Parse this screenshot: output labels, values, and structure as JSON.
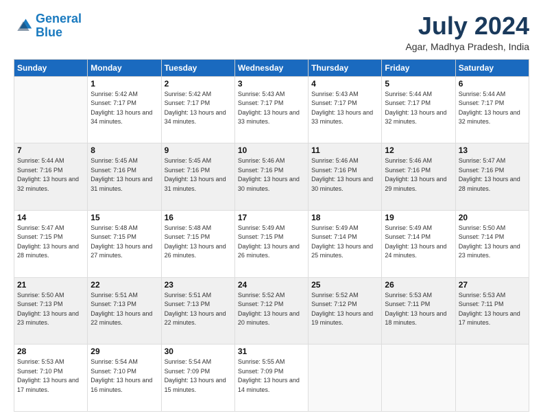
{
  "logo": {
    "line1": "General",
    "line2": "Blue"
  },
  "title": {
    "month_year": "July 2024",
    "location": "Agar, Madhya Pradesh, India"
  },
  "weekdays": [
    "Sunday",
    "Monday",
    "Tuesday",
    "Wednesday",
    "Thursday",
    "Friday",
    "Saturday"
  ],
  "weeks": [
    [
      {
        "day": "",
        "sunrise": "",
        "sunset": "",
        "daylight": ""
      },
      {
        "day": "1",
        "sunrise": "Sunrise: 5:42 AM",
        "sunset": "Sunset: 7:17 PM",
        "daylight": "Daylight: 13 hours and 34 minutes."
      },
      {
        "day": "2",
        "sunrise": "Sunrise: 5:42 AM",
        "sunset": "Sunset: 7:17 PM",
        "daylight": "Daylight: 13 hours and 34 minutes."
      },
      {
        "day": "3",
        "sunrise": "Sunrise: 5:43 AM",
        "sunset": "Sunset: 7:17 PM",
        "daylight": "Daylight: 13 hours and 33 minutes."
      },
      {
        "day": "4",
        "sunrise": "Sunrise: 5:43 AM",
        "sunset": "Sunset: 7:17 PM",
        "daylight": "Daylight: 13 hours and 33 minutes."
      },
      {
        "day": "5",
        "sunrise": "Sunrise: 5:44 AM",
        "sunset": "Sunset: 7:17 PM",
        "daylight": "Daylight: 13 hours and 32 minutes."
      },
      {
        "day": "6",
        "sunrise": "Sunrise: 5:44 AM",
        "sunset": "Sunset: 7:17 PM",
        "daylight": "Daylight: 13 hours and 32 minutes."
      }
    ],
    [
      {
        "day": "7",
        "sunrise": "Sunrise: 5:44 AM",
        "sunset": "Sunset: 7:16 PM",
        "daylight": "Daylight: 13 hours and 32 minutes."
      },
      {
        "day": "8",
        "sunrise": "Sunrise: 5:45 AM",
        "sunset": "Sunset: 7:16 PM",
        "daylight": "Daylight: 13 hours and 31 minutes."
      },
      {
        "day": "9",
        "sunrise": "Sunrise: 5:45 AM",
        "sunset": "Sunset: 7:16 PM",
        "daylight": "Daylight: 13 hours and 31 minutes."
      },
      {
        "day": "10",
        "sunrise": "Sunrise: 5:46 AM",
        "sunset": "Sunset: 7:16 PM",
        "daylight": "Daylight: 13 hours and 30 minutes."
      },
      {
        "day": "11",
        "sunrise": "Sunrise: 5:46 AM",
        "sunset": "Sunset: 7:16 PM",
        "daylight": "Daylight: 13 hours and 30 minutes."
      },
      {
        "day": "12",
        "sunrise": "Sunrise: 5:46 AM",
        "sunset": "Sunset: 7:16 PM",
        "daylight": "Daylight: 13 hours and 29 minutes."
      },
      {
        "day": "13",
        "sunrise": "Sunrise: 5:47 AM",
        "sunset": "Sunset: 7:16 PM",
        "daylight": "Daylight: 13 hours and 28 minutes."
      }
    ],
    [
      {
        "day": "14",
        "sunrise": "Sunrise: 5:47 AM",
        "sunset": "Sunset: 7:15 PM",
        "daylight": "Daylight: 13 hours and 28 minutes."
      },
      {
        "day": "15",
        "sunrise": "Sunrise: 5:48 AM",
        "sunset": "Sunset: 7:15 PM",
        "daylight": "Daylight: 13 hours and 27 minutes."
      },
      {
        "day": "16",
        "sunrise": "Sunrise: 5:48 AM",
        "sunset": "Sunset: 7:15 PM",
        "daylight": "Daylight: 13 hours and 26 minutes."
      },
      {
        "day": "17",
        "sunrise": "Sunrise: 5:49 AM",
        "sunset": "Sunset: 7:15 PM",
        "daylight": "Daylight: 13 hours and 26 minutes."
      },
      {
        "day": "18",
        "sunrise": "Sunrise: 5:49 AM",
        "sunset": "Sunset: 7:14 PM",
        "daylight": "Daylight: 13 hours and 25 minutes."
      },
      {
        "day": "19",
        "sunrise": "Sunrise: 5:49 AM",
        "sunset": "Sunset: 7:14 PM",
        "daylight": "Daylight: 13 hours and 24 minutes."
      },
      {
        "day": "20",
        "sunrise": "Sunrise: 5:50 AM",
        "sunset": "Sunset: 7:14 PM",
        "daylight": "Daylight: 13 hours and 23 minutes."
      }
    ],
    [
      {
        "day": "21",
        "sunrise": "Sunrise: 5:50 AM",
        "sunset": "Sunset: 7:13 PM",
        "daylight": "Daylight: 13 hours and 23 minutes."
      },
      {
        "day": "22",
        "sunrise": "Sunrise: 5:51 AM",
        "sunset": "Sunset: 7:13 PM",
        "daylight": "Daylight: 13 hours and 22 minutes."
      },
      {
        "day": "23",
        "sunrise": "Sunrise: 5:51 AM",
        "sunset": "Sunset: 7:13 PM",
        "daylight": "Daylight: 13 hours and 22 minutes."
      },
      {
        "day": "24",
        "sunrise": "Sunrise: 5:52 AM",
        "sunset": "Sunset: 7:12 PM",
        "daylight": "Daylight: 13 hours and 20 minutes."
      },
      {
        "day": "25",
        "sunrise": "Sunrise: 5:52 AM",
        "sunset": "Sunset: 7:12 PM",
        "daylight": "Daylight: 13 hours and 19 minutes."
      },
      {
        "day": "26",
        "sunrise": "Sunrise: 5:53 AM",
        "sunset": "Sunset: 7:11 PM",
        "daylight": "Daylight: 13 hours and 18 minutes."
      },
      {
        "day": "27",
        "sunrise": "Sunrise: 5:53 AM",
        "sunset": "Sunset: 7:11 PM",
        "daylight": "Daylight: 13 hours and 17 minutes."
      }
    ],
    [
      {
        "day": "28",
        "sunrise": "Sunrise: 5:53 AM",
        "sunset": "Sunset: 7:10 PM",
        "daylight": "Daylight: 13 hours and 17 minutes."
      },
      {
        "day": "29",
        "sunrise": "Sunrise: 5:54 AM",
        "sunset": "Sunset: 7:10 PM",
        "daylight": "Daylight: 13 hours and 16 minutes."
      },
      {
        "day": "30",
        "sunrise": "Sunrise: 5:54 AM",
        "sunset": "Sunset: 7:09 PM",
        "daylight": "Daylight: 13 hours and 15 minutes."
      },
      {
        "day": "31",
        "sunrise": "Sunrise: 5:55 AM",
        "sunset": "Sunset: 7:09 PM",
        "daylight": "Daylight: 13 hours and 14 minutes."
      },
      {
        "day": "",
        "sunrise": "",
        "sunset": "",
        "daylight": ""
      },
      {
        "day": "",
        "sunrise": "",
        "sunset": "",
        "daylight": ""
      },
      {
        "day": "",
        "sunrise": "",
        "sunset": "",
        "daylight": ""
      }
    ]
  ]
}
